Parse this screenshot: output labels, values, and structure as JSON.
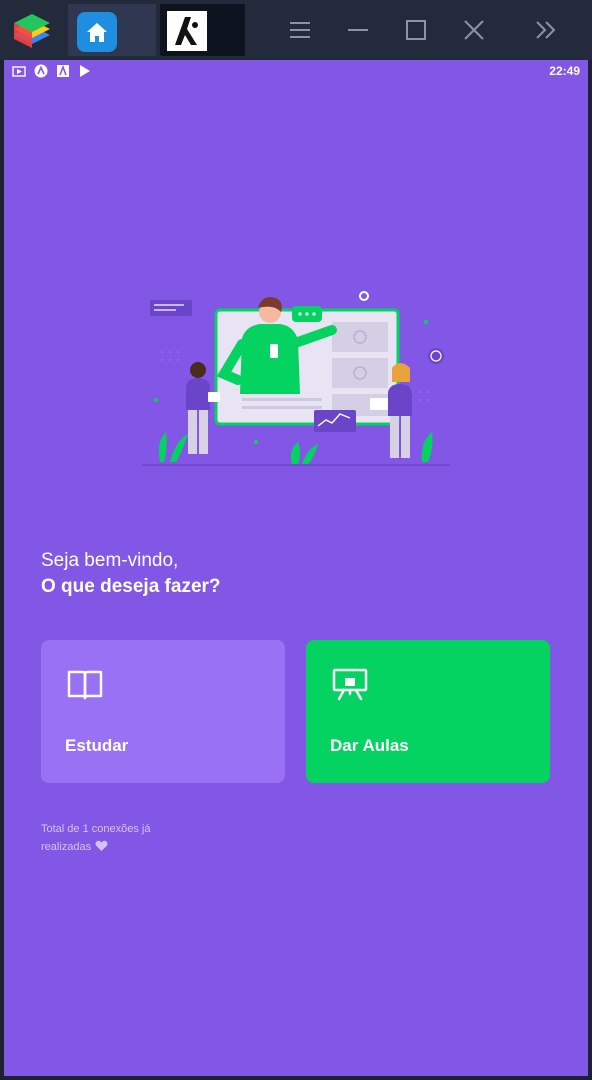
{
  "titlebar": {
    "icons": [
      "bluestacks-logo",
      "home-tab-icon",
      "app-tab-icon",
      "menu-icon",
      "minimize-icon",
      "maximize-icon",
      "close-icon",
      "expand-sidebar-icon"
    ]
  },
  "statusbar": {
    "time": "22:49",
    "icons": [
      "tv-icon",
      "android-a-icon",
      "font-a-icon",
      "play-store-icon"
    ]
  },
  "welcome": {
    "line1": "Seja bem-vindo,",
    "line2": "O que deseja fazer?"
  },
  "buttons": {
    "study_label": "Estudar",
    "teach_label": "Dar Aulas",
    "study_icon": "book-icon",
    "teach_icon": "presentation-icon"
  },
  "footer": {
    "total_connections": "Total de 1 conexões já realizadas",
    "heart_icon": "heart-icon"
  },
  "colors": {
    "primary": "#8257e5",
    "study_button": "#9871f5",
    "teach_button": "#04d361",
    "text_light": "#d4c2ff"
  }
}
